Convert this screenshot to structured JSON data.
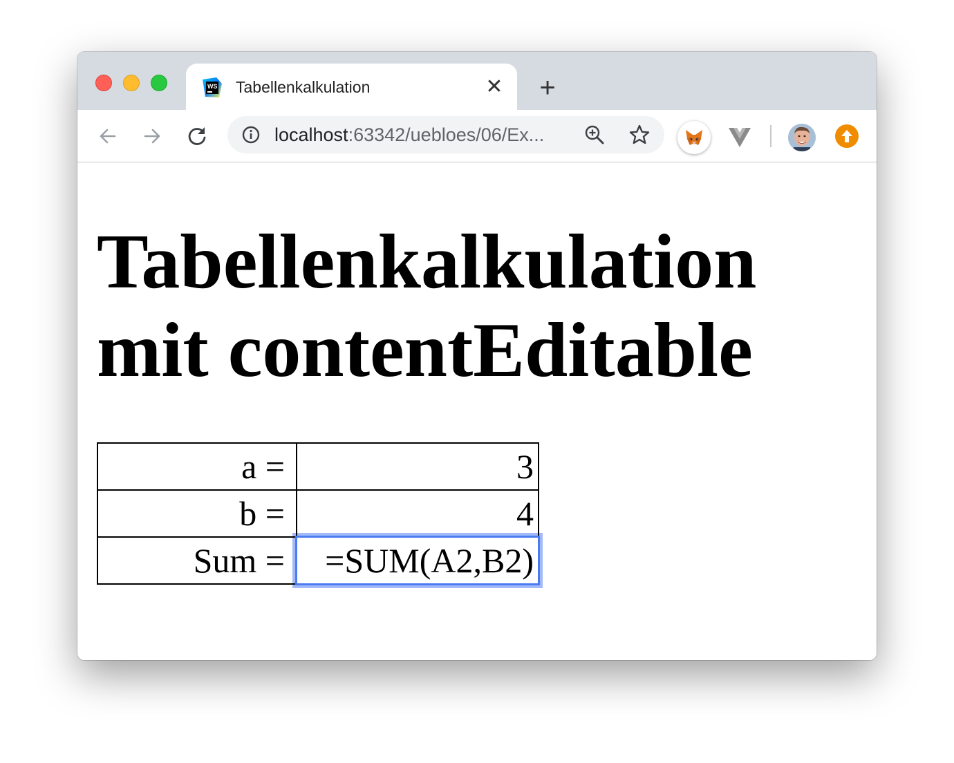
{
  "browser": {
    "tab": {
      "title": "Tabellenkalkulation",
      "close_glyph": "✕",
      "favicon": "webstorm-icon"
    },
    "new_tab_glyph": "+",
    "address": {
      "host": "localhost",
      "rest": ":63342/uebloes/06/Ex..."
    },
    "extensions": [
      "metamask-fox-icon",
      "vue-devtools-icon",
      "profile-avatar",
      "update-icon"
    ]
  },
  "page": {
    "heading": "Tabellenkalkulation mit contentEditable",
    "table": {
      "rows": [
        {
          "label": "a =",
          "value": "3"
        },
        {
          "label": "b =",
          "value": "4"
        },
        {
          "label": "Sum =",
          "value": "=SUM(A2,B2)"
        }
      ]
    }
  },
  "colors": {
    "tabstrip": "#d6dbe2",
    "focus_ring": "#4a7cf0",
    "update_badge": "#f08c00"
  }
}
